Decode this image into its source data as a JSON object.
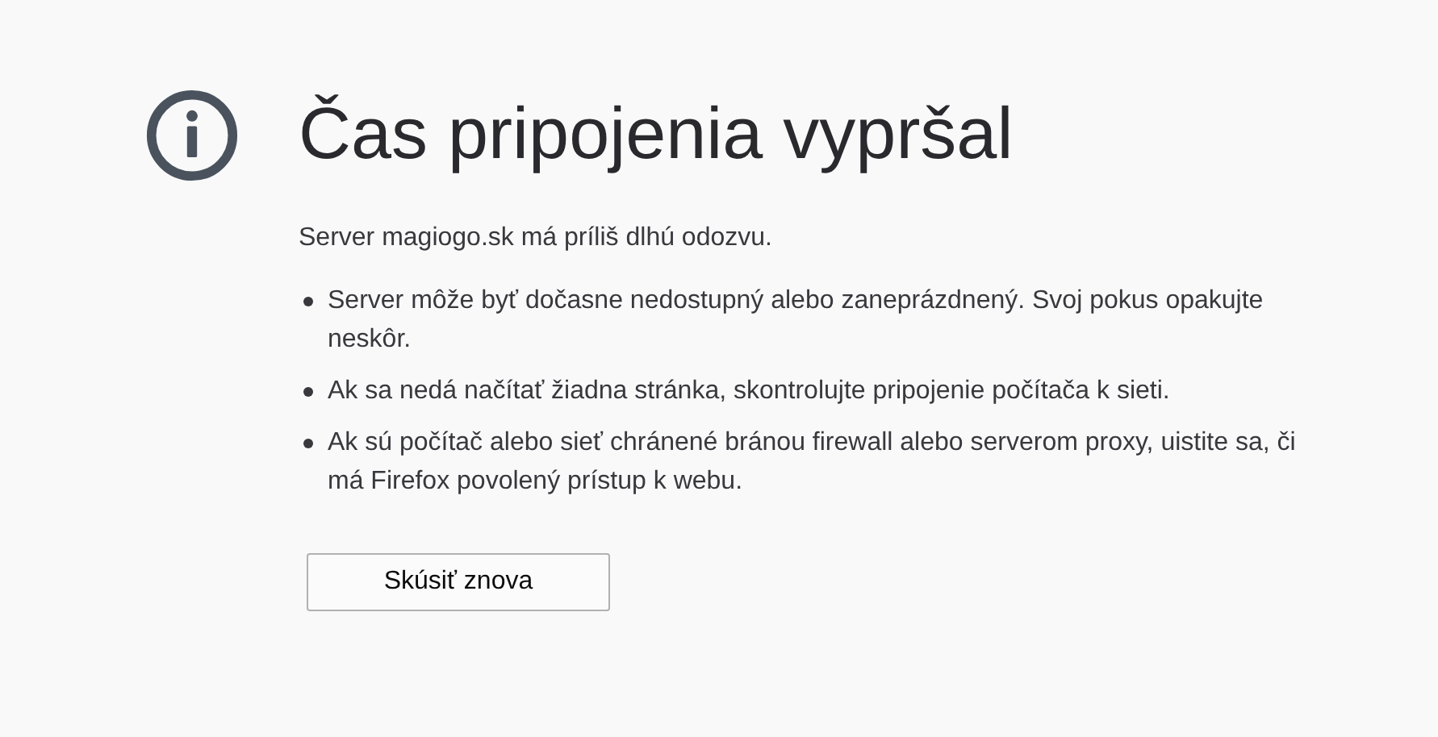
{
  "title": "Čas pripojenia vypršal",
  "description": "Server magiogo.sk má príliš dlhú odozvu.",
  "tips": [
    "Server môže byť dočasne nedostupný alebo zaneprázdnený. Svoj pokus opakujte neskôr.",
    "Ak sa nedá načítať žiadna stránka, skontrolujte pripojenie počítača k sieti.",
    "Ak sú počítač alebo sieť chránené bránou firewall alebo serverom proxy, uistite sa, či má Firefox povolený prístup k webu."
  ],
  "button": "Skúsiť znova"
}
